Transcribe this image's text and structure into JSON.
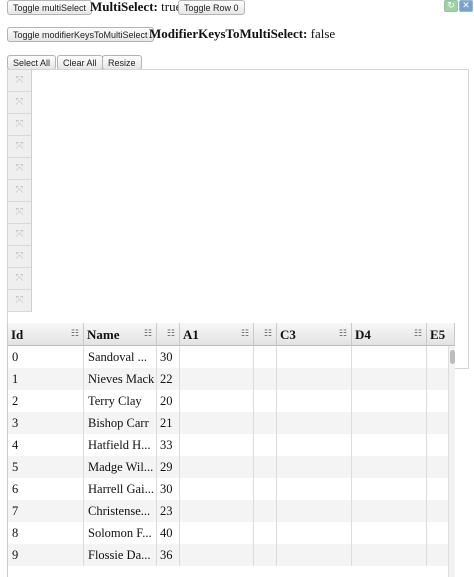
{
  "toolbar": {
    "toggle_multiselect": "Toggle multiSelect",
    "multiselect_label": "MultiSelect:",
    "multiselect_value": "true",
    "toggle_row0": "Toggle Row 0",
    "toggle_modifier": "Toggle modifierKeysToMultiSelect",
    "modifier_label": "ModifierKeysToMultiSelect:",
    "modifier_value": "false",
    "select_all": "Select All",
    "clear_all": "Clear All",
    "resize": "Resize"
  },
  "grid": {
    "columns": [
      "Id",
      "Name",
      "",
      "A1",
      "",
      "C3",
      "D4",
      "E5"
    ],
    "rows": [
      {
        "id": "0",
        "name": "Sandoval ...",
        "age": "30"
      },
      {
        "id": "1",
        "name": "Nieves Mack",
        "age": "22"
      },
      {
        "id": "2",
        "name": "Terry Clay",
        "age": "20"
      },
      {
        "id": "3",
        "name": "Bishop Carr",
        "age": "21"
      },
      {
        "id": "4",
        "name": "Hatfield H...",
        "age": "33"
      },
      {
        "id": "5",
        "name": "Madge Wil...",
        "age": "29"
      },
      {
        "id": "6",
        "name": "Harrell Gai...",
        "age": "30"
      },
      {
        "id": "7",
        "name": "Christense...",
        "age": "23"
      },
      {
        "id": "8",
        "name": "Solomon F...",
        "age": "40"
      },
      {
        "id": "9",
        "name": "Flossie Da...",
        "age": "36"
      }
    ]
  },
  "icons": {
    "row_header": "fullscreen-arrows-icon",
    "column_menu": "menu-icon"
  }
}
